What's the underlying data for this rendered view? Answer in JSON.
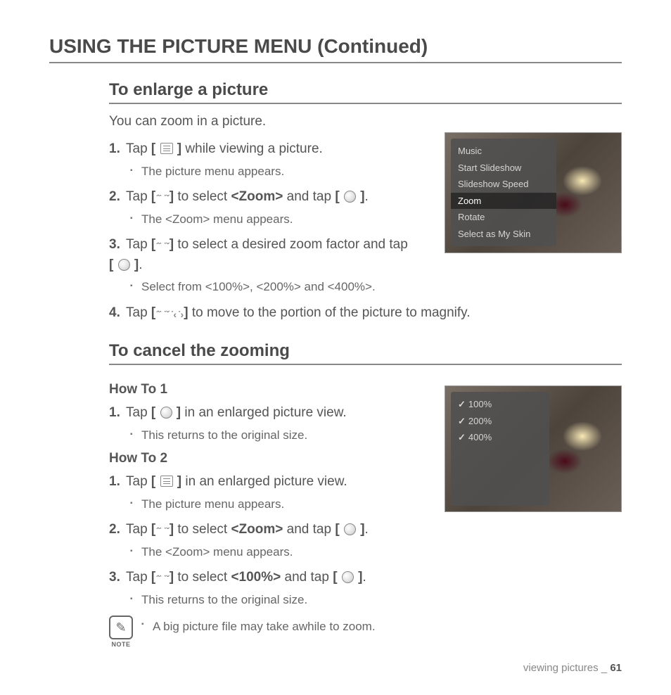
{
  "page_title": "USING THE PICTURE MENU (Continued)",
  "section1": {
    "title": "To enlarge a picture",
    "intro": "You can zoom in a picture.",
    "steps": [
      {
        "num": "1.",
        "pre": "Tap ",
        "icon": "menu",
        "post": " while viewing a picture.",
        "sub": [
          "The picture menu appears."
        ]
      },
      {
        "num": "2.",
        "pre": "Tap ",
        "icon": "ud",
        "mid1": " to select ",
        "strong1": "<Zoom>",
        "mid2": " and tap ",
        "icon2": "circle",
        "post": ".",
        "sub": [
          "The <Zoom> menu appears."
        ]
      },
      {
        "num": "3.",
        "pre": "Tap ",
        "icon": "ud",
        "post": " to select a desired zoom factor and tap ",
        "icon2": "circle",
        "post2": ".",
        "sub": [
          "Select from <100%>, <200%> and <400%>."
        ]
      },
      {
        "num": "4.",
        "pre": "Tap ",
        "icon": "all",
        "post": " to move to the portion of the picture to magnify."
      }
    ]
  },
  "section2": {
    "title": "To cancel the zooming",
    "howto1": "How To 1",
    "steps1": [
      {
        "num": "1.",
        "pre": "Tap ",
        "icon": "circle",
        "post": " in an enlarged picture view.",
        "sub": [
          "This returns to the original size."
        ]
      }
    ],
    "howto2": "How To 2",
    "steps2": [
      {
        "num": "1.",
        "pre": "Tap ",
        "icon": "menu",
        "post": " in an enlarged picture view.",
        "sub": [
          "The picture menu appears."
        ]
      },
      {
        "num": "2.",
        "pre": "Tap ",
        "icon": "ud",
        "mid1": " to select ",
        "strong1": "<Zoom>",
        "mid2": " and tap ",
        "icon2": "circle",
        "post": ".",
        "sub": [
          "The <Zoom> menu appears."
        ]
      },
      {
        "num": "3.",
        "pre": "Tap ",
        "icon": "ud",
        "mid1": " to select ",
        "strong1": "<100%>",
        "mid2": " and tap ",
        "icon2": "circle",
        "post": ".",
        "sub": [
          "This returns to the original size."
        ]
      }
    ],
    "note_label": "NOTE",
    "note_text": "A big picture file may take awhile to zoom."
  },
  "screenshot1": {
    "items": [
      "Music",
      "Start Slideshow",
      "Slideshow Speed",
      "Zoom",
      "Rotate",
      "Select as My Skin"
    ],
    "selected": "Zoom"
  },
  "screenshot2": {
    "items": [
      "100%",
      "200%",
      "400%"
    ]
  },
  "footer": {
    "text": "viewing pictures _ ",
    "page": "61"
  }
}
